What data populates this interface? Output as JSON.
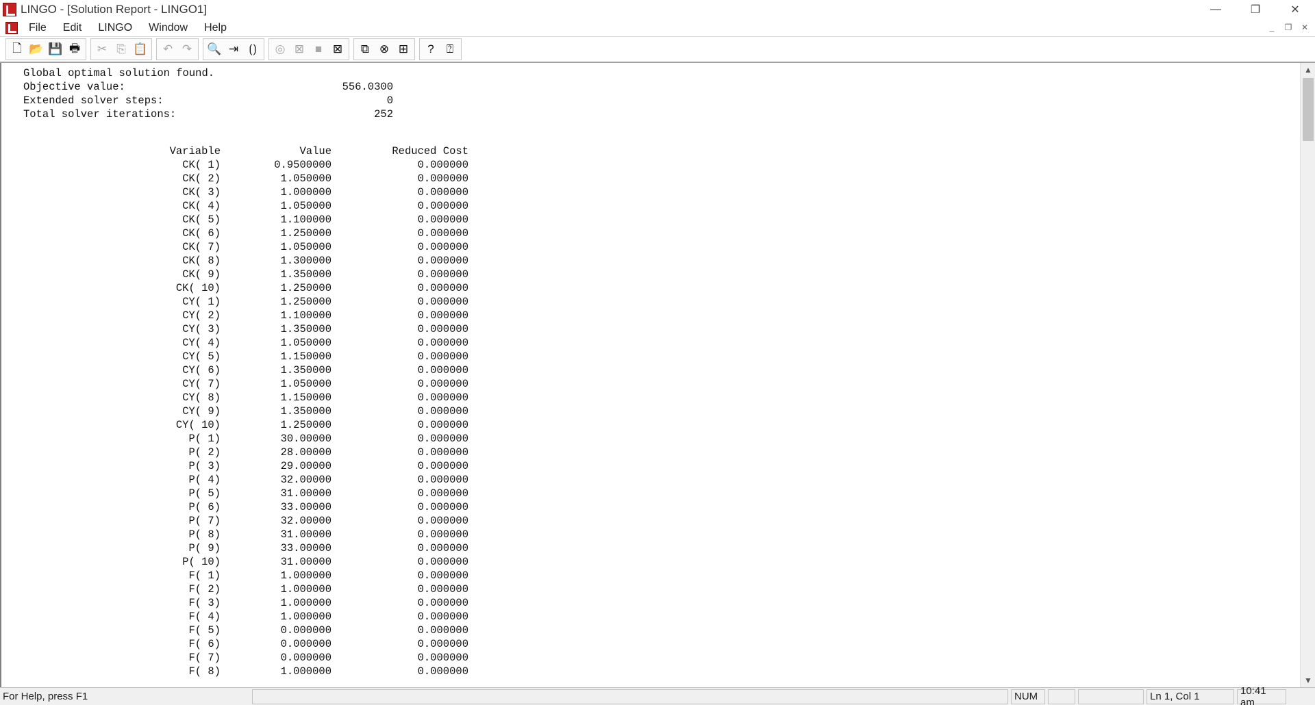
{
  "window": {
    "title": "LINGO - [Solution Report - LINGO1]",
    "controls": {
      "minimize": "—",
      "restore": "❐",
      "close": "✕"
    }
  },
  "menu": {
    "items": [
      "File",
      "Edit",
      "LINGO",
      "Window",
      "Help"
    ],
    "mdi": {
      "minimize": "_",
      "restore": "❐",
      "close": "✕"
    }
  },
  "toolbar": {
    "groups": [
      [
        {
          "icon": "new-file-icon",
          "glyph": "🗋",
          "enabled": true
        },
        {
          "icon": "open-file-icon",
          "glyph": "📂",
          "enabled": true
        },
        {
          "icon": "save-icon",
          "glyph": "💾",
          "enabled": true
        },
        {
          "icon": "print-icon",
          "glyph": "🖶",
          "enabled": true
        }
      ],
      [
        {
          "icon": "cut-icon",
          "glyph": "✂",
          "enabled": false
        },
        {
          "icon": "copy-icon",
          "glyph": "⎘",
          "enabled": false
        },
        {
          "icon": "paste-icon",
          "glyph": "📋",
          "enabled": true
        }
      ],
      [
        {
          "icon": "undo-icon",
          "glyph": "↶",
          "enabled": false
        },
        {
          "icon": "redo-icon",
          "glyph": "↷",
          "enabled": false
        }
      ],
      [
        {
          "icon": "find-icon",
          "glyph": "🔍",
          "enabled": true
        },
        {
          "icon": "goto-line-icon",
          "glyph": "⇥",
          "enabled": true
        },
        {
          "icon": "match-parenthesis-icon",
          "glyph": "⟮⟯",
          "enabled": true
        }
      ],
      [
        {
          "icon": "solve-icon",
          "glyph": "◎",
          "enabled": false
        },
        {
          "icon": "solution-icon",
          "glyph": "⊠",
          "enabled": false
        },
        {
          "icon": "matrix-picture-icon",
          "glyph": "■",
          "enabled": false
        },
        {
          "icon": "options-icon",
          "glyph": "⊠",
          "enabled": true
        }
      ],
      [
        {
          "icon": "send-to-back-icon",
          "glyph": "⧉",
          "enabled": true
        },
        {
          "icon": "close-all-icon",
          "glyph": "⊗",
          "enabled": true
        },
        {
          "icon": "tile-icon",
          "glyph": "⊞",
          "enabled": true
        }
      ],
      [
        {
          "icon": "help-topics-icon",
          "glyph": "?",
          "enabled": true
        },
        {
          "icon": "context-help-icon",
          "glyph": "⍰",
          "enabled": true
        }
      ]
    ]
  },
  "report": {
    "summary": [
      {
        "label": "Global optimal solution found.",
        "value": ""
      },
      {
        "label": "Objective value:",
        "value": "556.0300"
      },
      {
        "label": "Extended solver steps:",
        "value": "0"
      },
      {
        "label": "Total solver iterations:",
        "value": "252"
      }
    ],
    "columns": [
      "Variable",
      "Value",
      "Reduced Cost"
    ],
    "rows": [
      [
        "CK( 1)",
        "0.9500000",
        "0.000000"
      ],
      [
        "CK( 2)",
        "1.050000",
        "0.000000"
      ],
      [
        "CK( 3)",
        "1.000000",
        "0.000000"
      ],
      [
        "CK( 4)",
        "1.050000",
        "0.000000"
      ],
      [
        "CK( 5)",
        "1.100000",
        "0.000000"
      ],
      [
        "CK( 6)",
        "1.250000",
        "0.000000"
      ],
      [
        "CK( 7)",
        "1.050000",
        "0.000000"
      ],
      [
        "CK( 8)",
        "1.300000",
        "0.000000"
      ],
      [
        "CK( 9)",
        "1.350000",
        "0.000000"
      ],
      [
        "CK( 10)",
        "1.250000",
        "0.000000"
      ],
      [
        "CY( 1)",
        "1.250000",
        "0.000000"
      ],
      [
        "CY( 2)",
        "1.100000",
        "0.000000"
      ],
      [
        "CY( 3)",
        "1.350000",
        "0.000000"
      ],
      [
        "CY( 4)",
        "1.050000",
        "0.000000"
      ],
      [
        "CY( 5)",
        "1.150000",
        "0.000000"
      ],
      [
        "CY( 6)",
        "1.350000",
        "0.000000"
      ],
      [
        "CY( 7)",
        "1.050000",
        "0.000000"
      ],
      [
        "CY( 8)",
        "1.150000",
        "0.000000"
      ],
      [
        "CY( 9)",
        "1.350000",
        "0.000000"
      ],
      [
        "CY( 10)",
        "1.250000",
        "0.000000"
      ],
      [
        "P( 1)",
        "30.00000",
        "0.000000"
      ],
      [
        "P( 2)",
        "28.00000",
        "0.000000"
      ],
      [
        "P( 3)",
        "29.00000",
        "0.000000"
      ],
      [
        "P( 4)",
        "32.00000",
        "0.000000"
      ],
      [
        "P( 5)",
        "31.00000",
        "0.000000"
      ],
      [
        "P( 6)",
        "33.00000",
        "0.000000"
      ],
      [
        "P( 7)",
        "32.00000",
        "0.000000"
      ],
      [
        "P( 8)",
        "31.00000",
        "0.000000"
      ],
      [
        "P( 9)",
        "33.00000",
        "0.000000"
      ],
      [
        "P( 10)",
        "31.00000",
        "0.000000"
      ],
      [
        "F( 1)",
        "1.000000",
        "0.000000"
      ],
      [
        "F( 2)",
        "1.000000",
        "0.000000"
      ],
      [
        "F( 3)",
        "1.000000",
        "0.000000"
      ],
      [
        "F( 4)",
        "1.000000",
        "0.000000"
      ],
      [
        "F( 5)",
        "0.000000",
        "0.000000"
      ],
      [
        "F( 6)",
        "0.000000",
        "0.000000"
      ],
      [
        "F( 7)",
        "0.000000",
        "0.000000"
      ],
      [
        "F( 8)",
        "1.000000",
        "0.000000"
      ]
    ]
  },
  "statusbar": {
    "help": "For Help, press F1",
    "num": "NUM",
    "position": "Ln 1, Col 1",
    "time": "10:41 am"
  }
}
